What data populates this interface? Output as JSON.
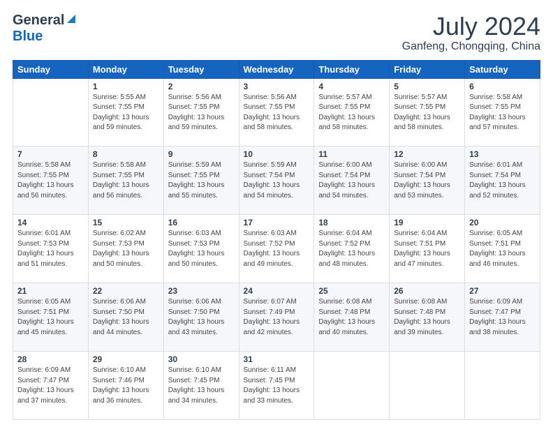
{
  "header": {
    "logo_general": "General",
    "logo_blue": "Blue",
    "month_year": "July 2024",
    "location": "Ganfeng, Chongqing, China"
  },
  "days_of_week": [
    "Sunday",
    "Monday",
    "Tuesday",
    "Wednesday",
    "Thursday",
    "Friday",
    "Saturday"
  ],
  "weeks": [
    [
      {
        "day": "",
        "info": ""
      },
      {
        "day": "1",
        "info": "Sunrise: 5:55 AM\nSunset: 7:55 PM\nDaylight: 13 hours\nand 59 minutes."
      },
      {
        "day": "2",
        "info": "Sunrise: 5:56 AM\nSunset: 7:55 PM\nDaylight: 13 hours\nand 59 minutes."
      },
      {
        "day": "3",
        "info": "Sunrise: 5:56 AM\nSunset: 7:55 PM\nDaylight: 13 hours\nand 58 minutes."
      },
      {
        "day": "4",
        "info": "Sunrise: 5:57 AM\nSunset: 7:55 PM\nDaylight: 13 hours\nand 58 minutes."
      },
      {
        "day": "5",
        "info": "Sunrise: 5:57 AM\nSunset: 7:55 PM\nDaylight: 13 hours\nand 58 minutes."
      },
      {
        "day": "6",
        "info": "Sunrise: 5:58 AM\nSunset: 7:55 PM\nDaylight: 13 hours\nand 57 minutes."
      }
    ],
    [
      {
        "day": "7",
        "info": "Sunrise: 5:58 AM\nSunset: 7:55 PM\nDaylight: 13 hours\nand 56 minutes."
      },
      {
        "day": "8",
        "info": "Sunrise: 5:58 AM\nSunset: 7:55 PM\nDaylight: 13 hours\nand 56 minutes."
      },
      {
        "day": "9",
        "info": "Sunrise: 5:59 AM\nSunset: 7:55 PM\nDaylight: 13 hours\nand 55 minutes."
      },
      {
        "day": "10",
        "info": "Sunrise: 5:59 AM\nSunset: 7:54 PM\nDaylight: 13 hours\nand 54 minutes."
      },
      {
        "day": "11",
        "info": "Sunrise: 6:00 AM\nSunset: 7:54 PM\nDaylight: 13 hours\nand 54 minutes."
      },
      {
        "day": "12",
        "info": "Sunrise: 6:00 AM\nSunset: 7:54 PM\nDaylight: 13 hours\nand 53 minutes."
      },
      {
        "day": "13",
        "info": "Sunrise: 6:01 AM\nSunset: 7:54 PM\nDaylight: 13 hours\nand 52 minutes."
      }
    ],
    [
      {
        "day": "14",
        "info": "Sunrise: 6:01 AM\nSunset: 7:53 PM\nDaylight: 13 hours\nand 51 minutes."
      },
      {
        "day": "15",
        "info": "Sunrise: 6:02 AM\nSunset: 7:53 PM\nDaylight: 13 hours\nand 50 minutes."
      },
      {
        "day": "16",
        "info": "Sunrise: 6:03 AM\nSunset: 7:53 PM\nDaylight: 13 hours\nand 50 minutes."
      },
      {
        "day": "17",
        "info": "Sunrise: 6:03 AM\nSunset: 7:52 PM\nDaylight: 13 hours\nand 49 minutes."
      },
      {
        "day": "18",
        "info": "Sunrise: 6:04 AM\nSunset: 7:52 PM\nDaylight: 13 hours\nand 48 minutes."
      },
      {
        "day": "19",
        "info": "Sunrise: 6:04 AM\nSunset: 7:51 PM\nDaylight: 13 hours\nand 47 minutes."
      },
      {
        "day": "20",
        "info": "Sunrise: 6:05 AM\nSunset: 7:51 PM\nDaylight: 13 hours\nand 46 minutes."
      }
    ],
    [
      {
        "day": "21",
        "info": "Sunrise: 6:05 AM\nSunset: 7:51 PM\nDaylight: 13 hours\nand 45 minutes."
      },
      {
        "day": "22",
        "info": "Sunrise: 6:06 AM\nSunset: 7:50 PM\nDaylight: 13 hours\nand 44 minutes."
      },
      {
        "day": "23",
        "info": "Sunrise: 6:06 AM\nSunset: 7:50 PM\nDaylight: 13 hours\nand 43 minutes."
      },
      {
        "day": "24",
        "info": "Sunrise: 6:07 AM\nSunset: 7:49 PM\nDaylight: 13 hours\nand 42 minutes."
      },
      {
        "day": "25",
        "info": "Sunrise: 6:08 AM\nSunset: 7:48 PM\nDaylight: 13 hours\nand 40 minutes."
      },
      {
        "day": "26",
        "info": "Sunrise: 6:08 AM\nSunset: 7:48 PM\nDaylight: 13 hours\nand 39 minutes."
      },
      {
        "day": "27",
        "info": "Sunrise: 6:09 AM\nSunset: 7:47 PM\nDaylight: 13 hours\nand 38 minutes."
      }
    ],
    [
      {
        "day": "28",
        "info": "Sunrise: 6:09 AM\nSunset: 7:47 PM\nDaylight: 13 hours\nand 37 minutes."
      },
      {
        "day": "29",
        "info": "Sunrise: 6:10 AM\nSunset: 7:46 PM\nDaylight: 13 hours\nand 36 minutes."
      },
      {
        "day": "30",
        "info": "Sunrise: 6:10 AM\nSunset: 7:45 PM\nDaylight: 13 hours\nand 34 minutes."
      },
      {
        "day": "31",
        "info": "Sunrise: 6:11 AM\nSunset: 7:45 PM\nDaylight: 13 hours\nand 33 minutes."
      },
      {
        "day": "",
        "info": ""
      },
      {
        "day": "",
        "info": ""
      },
      {
        "day": "",
        "info": ""
      }
    ]
  ]
}
